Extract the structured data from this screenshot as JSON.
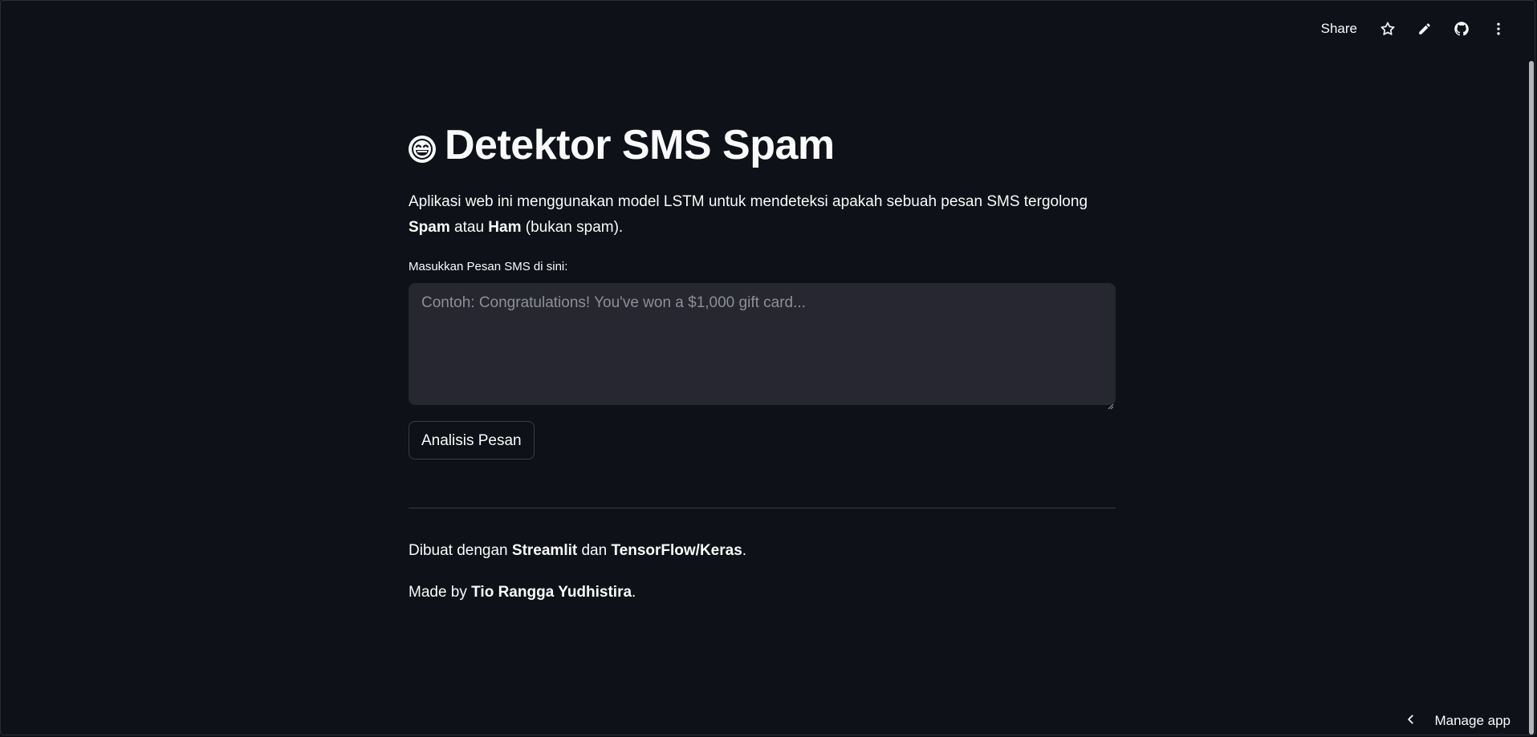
{
  "toolbar": {
    "share_label": "Share",
    "icons": [
      "star-icon",
      "pencil-icon",
      "github-icon",
      "more-vertical-icon"
    ]
  },
  "page": {
    "title_emoji": "laughing-face-emoji",
    "title": "Detektor SMS Spam",
    "intro": {
      "part1": "Aplikasi web ini menggunakan model LSTM untuk mendeteksi apakah sebuah pesan SMS tergolong ",
      "bold1": "Spam",
      "part2": " atau ",
      "bold2": "Ham",
      "part3": " (bukan spam)."
    },
    "input_label": "Masukkan Pesan SMS di sini:",
    "input_placeholder": "Contoh: Congratulations! You've won a $1,000 gift card...",
    "input_value": "",
    "button_label": "Analisis Pesan",
    "footer1": {
      "part1": "Dibuat dengan ",
      "bold1": "Streamlit",
      "part2": " dan ",
      "bold2": "TensorFlow/Keras",
      "part3": "."
    },
    "footer2": {
      "part1": "Made by ",
      "bold1": "Tio Rangga Yudhistira",
      "part2": "."
    }
  },
  "manage": {
    "label": "Manage app",
    "icon": "chevron-left-icon"
  },
  "colors": {
    "background": "#0e1117",
    "text": "#fafafa",
    "input_bg": "#262730",
    "placeholder": "#8d8f96"
  }
}
